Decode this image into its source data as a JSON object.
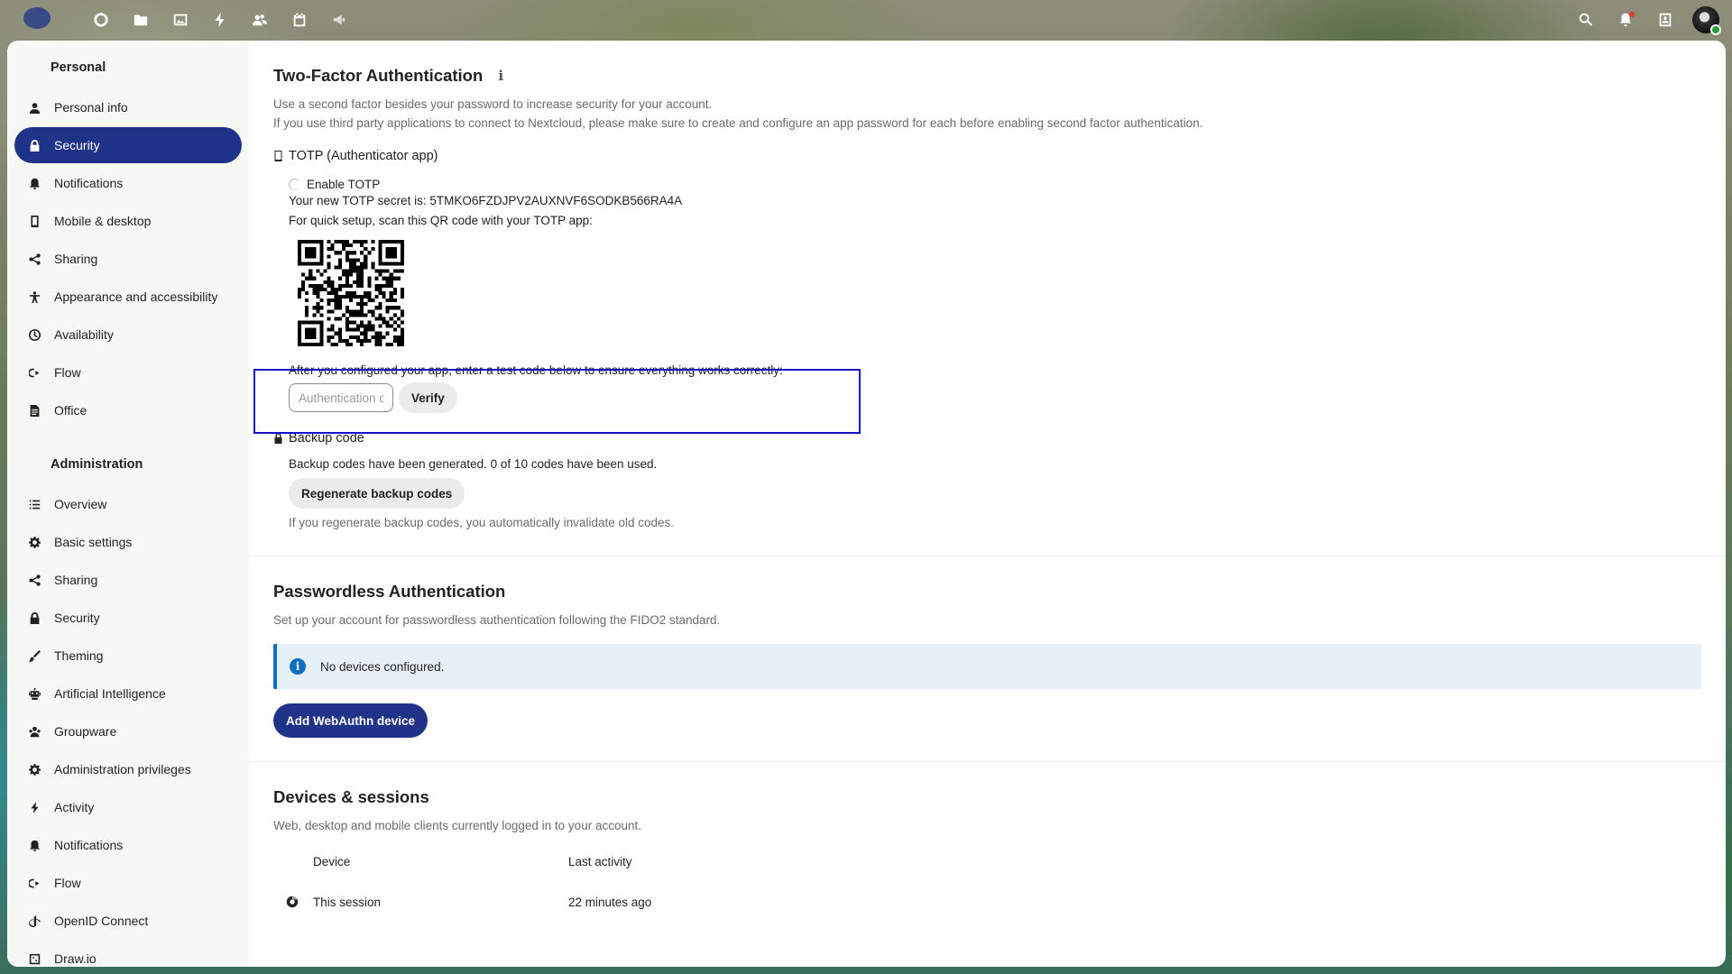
{
  "topbar": {
    "apps": [
      "dashboard-icon",
      "files-icon",
      "photos-icon",
      "activity-icon",
      "contacts-icon",
      "calendar-icon",
      "announcements-icon"
    ],
    "right": [
      "search-icon",
      "notifications-icon",
      "contacts-menu-icon",
      "avatar"
    ]
  },
  "sidebar": {
    "personal_heading": "Personal",
    "personal_items": [
      {
        "label": "Personal info",
        "icon": "user-icon"
      },
      {
        "label": "Security",
        "icon": "lock-icon",
        "active": true
      },
      {
        "label": "Notifications",
        "icon": "bell-icon"
      },
      {
        "label": "Mobile & desktop",
        "icon": "phone-icon"
      },
      {
        "label": "Sharing",
        "icon": "share-icon"
      },
      {
        "label": "Appearance and accessibility",
        "icon": "accessibility-icon"
      },
      {
        "label": "Availability",
        "icon": "clock-icon"
      },
      {
        "label": "Flow",
        "icon": "flow-icon"
      },
      {
        "label": "Office",
        "icon": "document-icon"
      }
    ],
    "admin_heading": "Administration",
    "admin_items": [
      {
        "label": "Overview",
        "icon": "list-icon"
      },
      {
        "label": "Basic settings",
        "icon": "gear-icon"
      },
      {
        "label": "Sharing",
        "icon": "share-icon"
      },
      {
        "label": "Security",
        "icon": "lock-icon"
      },
      {
        "label": "Theming",
        "icon": "brush-icon"
      },
      {
        "label": "Artificial Intelligence",
        "icon": "robot-icon"
      },
      {
        "label": "Groupware",
        "icon": "groupware-icon"
      },
      {
        "label": "Administration privileges",
        "icon": "gear-admin-icon"
      },
      {
        "label": "Activity",
        "icon": "bolt-icon"
      },
      {
        "label": "Notifications",
        "icon": "bell-icon"
      },
      {
        "label": "Flow",
        "icon": "flow-icon"
      },
      {
        "label": "OpenID Connect",
        "icon": "openid-icon"
      },
      {
        "label": "Draw.io",
        "icon": "drawio-icon"
      }
    ]
  },
  "twofactor": {
    "title": "Two-Factor Authentication",
    "desc1": "Use a second factor besides your password to increase security for your account.",
    "desc2": "If you use third party applications to connect to Nextcloud, please make sure to create and configure an app password for each before enabling second factor authentication.",
    "totp_title": "TOTP (Authenticator app)",
    "enable_label": "Enable TOTP",
    "secret_line": "Your new TOTP secret is: 5TMKO6FZDJPV2AUXNVF6SODKB566RA4A",
    "qr_hint": "For quick setup, scan this QR code with your TOTP app:",
    "verify_text": "After you configured your app, enter a test code below to ensure everything works correctly:",
    "input_placeholder": "Authentication code",
    "verify_label": "Verify",
    "backup_title": "Backup code",
    "backup_status": "Backup codes have been generated. 0 of 10 codes have been used.",
    "regenerate_label": "Regenerate backup codes",
    "regenerate_hint": "If you regenerate backup codes, you automatically invalidate old codes."
  },
  "passwordless": {
    "title": "Passwordless Authentication",
    "desc": "Set up your account for passwordless authentication following the FIDO2 standard.",
    "notice": "No devices configured.",
    "add_label": "Add WebAuthn device"
  },
  "devices": {
    "title": "Devices & sessions",
    "desc": "Web, desktop and mobile clients currently logged in to your account.",
    "col_device": "Device",
    "col_activity": "Last activity",
    "rows": [
      {
        "device": "This session",
        "activity": "22 minutes ago"
      }
    ]
  }
}
